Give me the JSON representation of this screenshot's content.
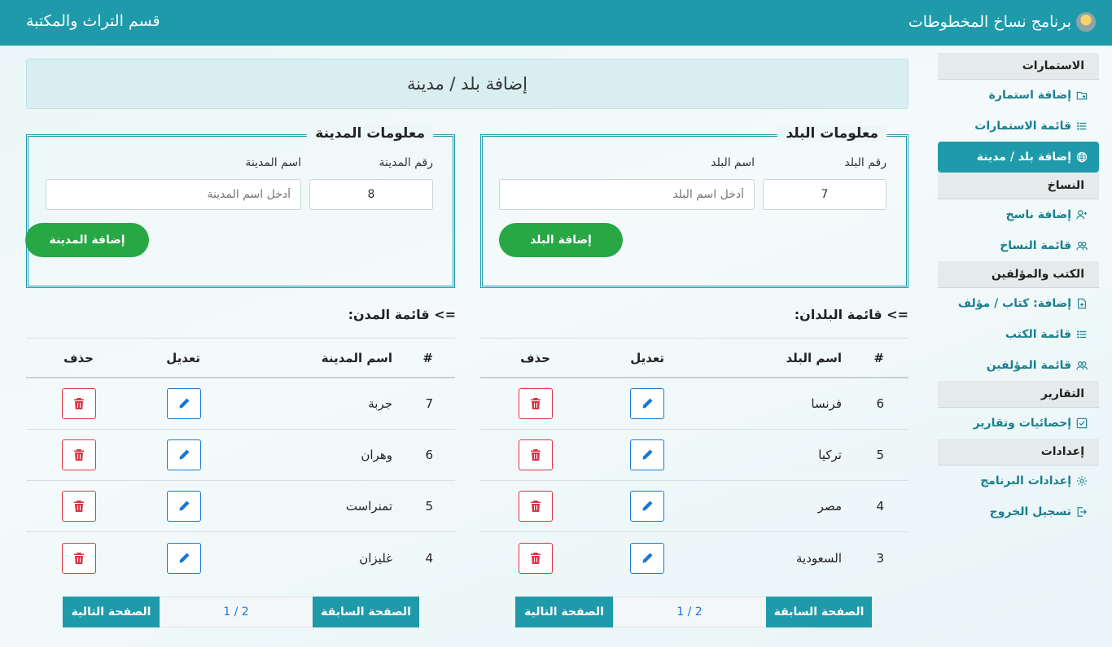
{
  "header": {
    "app_title": "برنامج نساخ المخطوطات",
    "department": "قسم التراث والمكتبة"
  },
  "sidebar": {
    "sections": [
      {
        "title": "الاستمارات",
        "items": [
          {
            "label": "إضافة استمارة",
            "icon": "folder-plus-icon"
          },
          {
            "label": "قائمة الاستمارات",
            "icon": "list-icon"
          },
          {
            "label": "إضافة بلد / مدينة",
            "icon": "globe-icon",
            "active": true
          }
        ]
      },
      {
        "title": "النساخ",
        "items": [
          {
            "label": "إضافة ناسخ",
            "icon": "user-plus-icon"
          },
          {
            "label": "قائمة النساخ",
            "icon": "users-icon"
          }
        ]
      },
      {
        "title": "الكتب والمؤلفين",
        "items": [
          {
            "label": "إضافة: كتاب / مؤلف",
            "icon": "file-plus-icon"
          },
          {
            "label": "قائمة الكتب",
            "icon": "list-icon"
          },
          {
            "label": "قائمة المؤلفين",
            "icon": "users-icon"
          }
        ]
      },
      {
        "title": "التقارير",
        "items": [
          {
            "label": "إحصائيات وتقارير",
            "icon": "check-square-icon"
          }
        ]
      },
      {
        "title": "إعدادات",
        "items": [
          {
            "label": "إعدادات البرنامج",
            "icon": "gear-icon"
          },
          {
            "label": "تسجيل الخروج",
            "icon": "logout-icon"
          }
        ]
      }
    ]
  },
  "page_title": "إضافة بلد / مدينة",
  "country_form": {
    "legend": "معلومات البلد",
    "number_label": "رقم البلد",
    "number_value": "7",
    "name_label": "اسم البلد",
    "name_placeholder": "أدخل اسم البلد",
    "submit_label": "إضافة البلد"
  },
  "city_form": {
    "legend": "معلومات المدينة",
    "number_label": "رقم المدينة",
    "number_value": "8",
    "name_label": "اسم المدينة",
    "name_placeholder": "أدخل اسم المدينة",
    "submit_label": "إضافة المدينة"
  },
  "countries": {
    "title": "=> قائمة البلدان:",
    "columns": [
      "#",
      "اسم البلد",
      "تعديل",
      "حذف"
    ],
    "rows": [
      {
        "id": "6",
        "name": "فرنسا"
      },
      {
        "id": "5",
        "name": "تركيا"
      },
      {
        "id": "4",
        "name": "مصر"
      },
      {
        "id": "3",
        "name": "السعودية"
      }
    ],
    "pager": {
      "prev": "الصفحة السابقة",
      "info": "1 / 2",
      "next": "الصفحة التالية"
    }
  },
  "cities": {
    "title": "=> قائمة المدن:",
    "columns": [
      "#",
      "اسم المدينة",
      "تعديل",
      "حذف"
    ],
    "rows": [
      {
        "id": "7",
        "name": "جربة"
      },
      {
        "id": "6",
        "name": "وهران"
      },
      {
        "id": "5",
        "name": "تمنراست"
      },
      {
        "id": "4",
        "name": "غليزان"
      }
    ],
    "pager": {
      "prev": "الصفحة السابقة",
      "info": "1 / 2",
      "next": "الصفحة التالية"
    }
  },
  "colors": {
    "primary": "#1e9aab",
    "success": "#28a745",
    "edit": "#1877d6",
    "delete": "#dc3545"
  }
}
